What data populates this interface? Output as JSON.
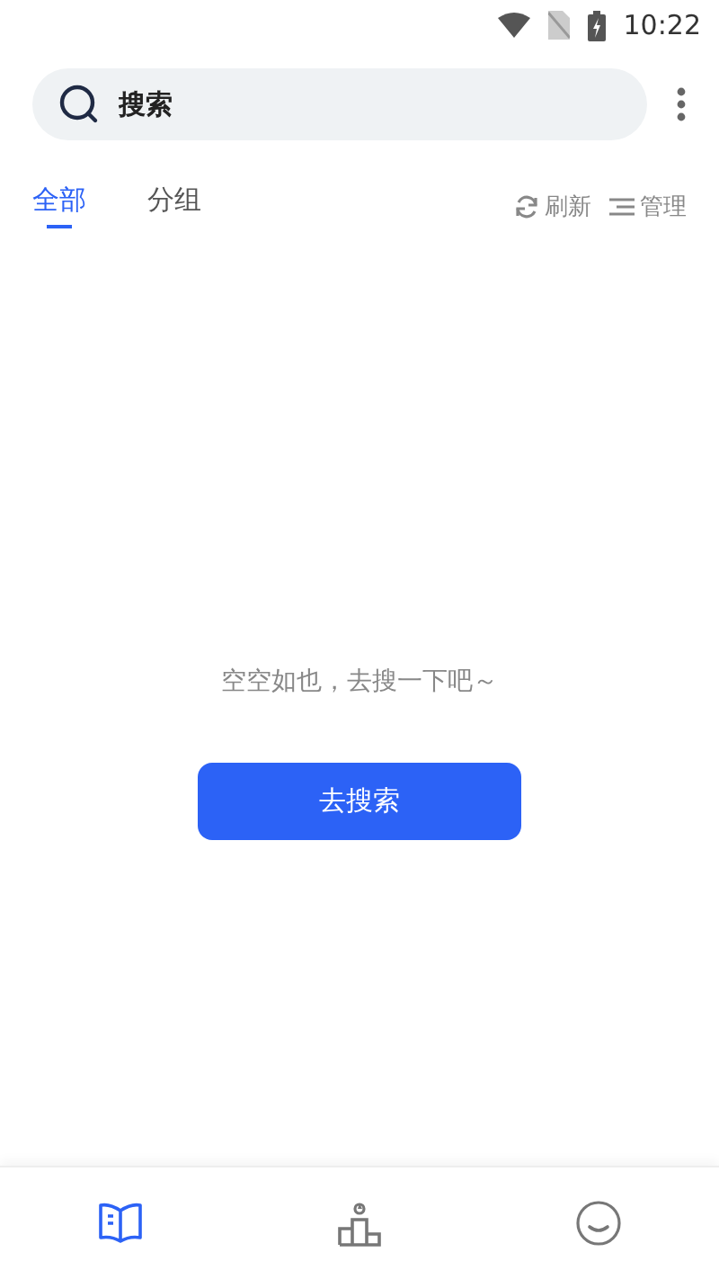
{
  "status_bar": {
    "time": "10:22"
  },
  "search": {
    "placeholder": "搜索"
  },
  "tabs": [
    {
      "label": "全部",
      "selected": true
    },
    {
      "label": "分组",
      "selected": false
    }
  ],
  "actions": [
    {
      "kind": "refresh",
      "label": "刷新"
    },
    {
      "kind": "manage",
      "label": "管理"
    }
  ],
  "empty_state": {
    "message": "空空如也，去搜一下吧～",
    "button": "去搜索"
  },
  "bottom_nav": [
    {
      "kind": "book",
      "selected": true
    },
    {
      "kind": "podium",
      "selected": false
    },
    {
      "kind": "face",
      "selected": false
    }
  ]
}
